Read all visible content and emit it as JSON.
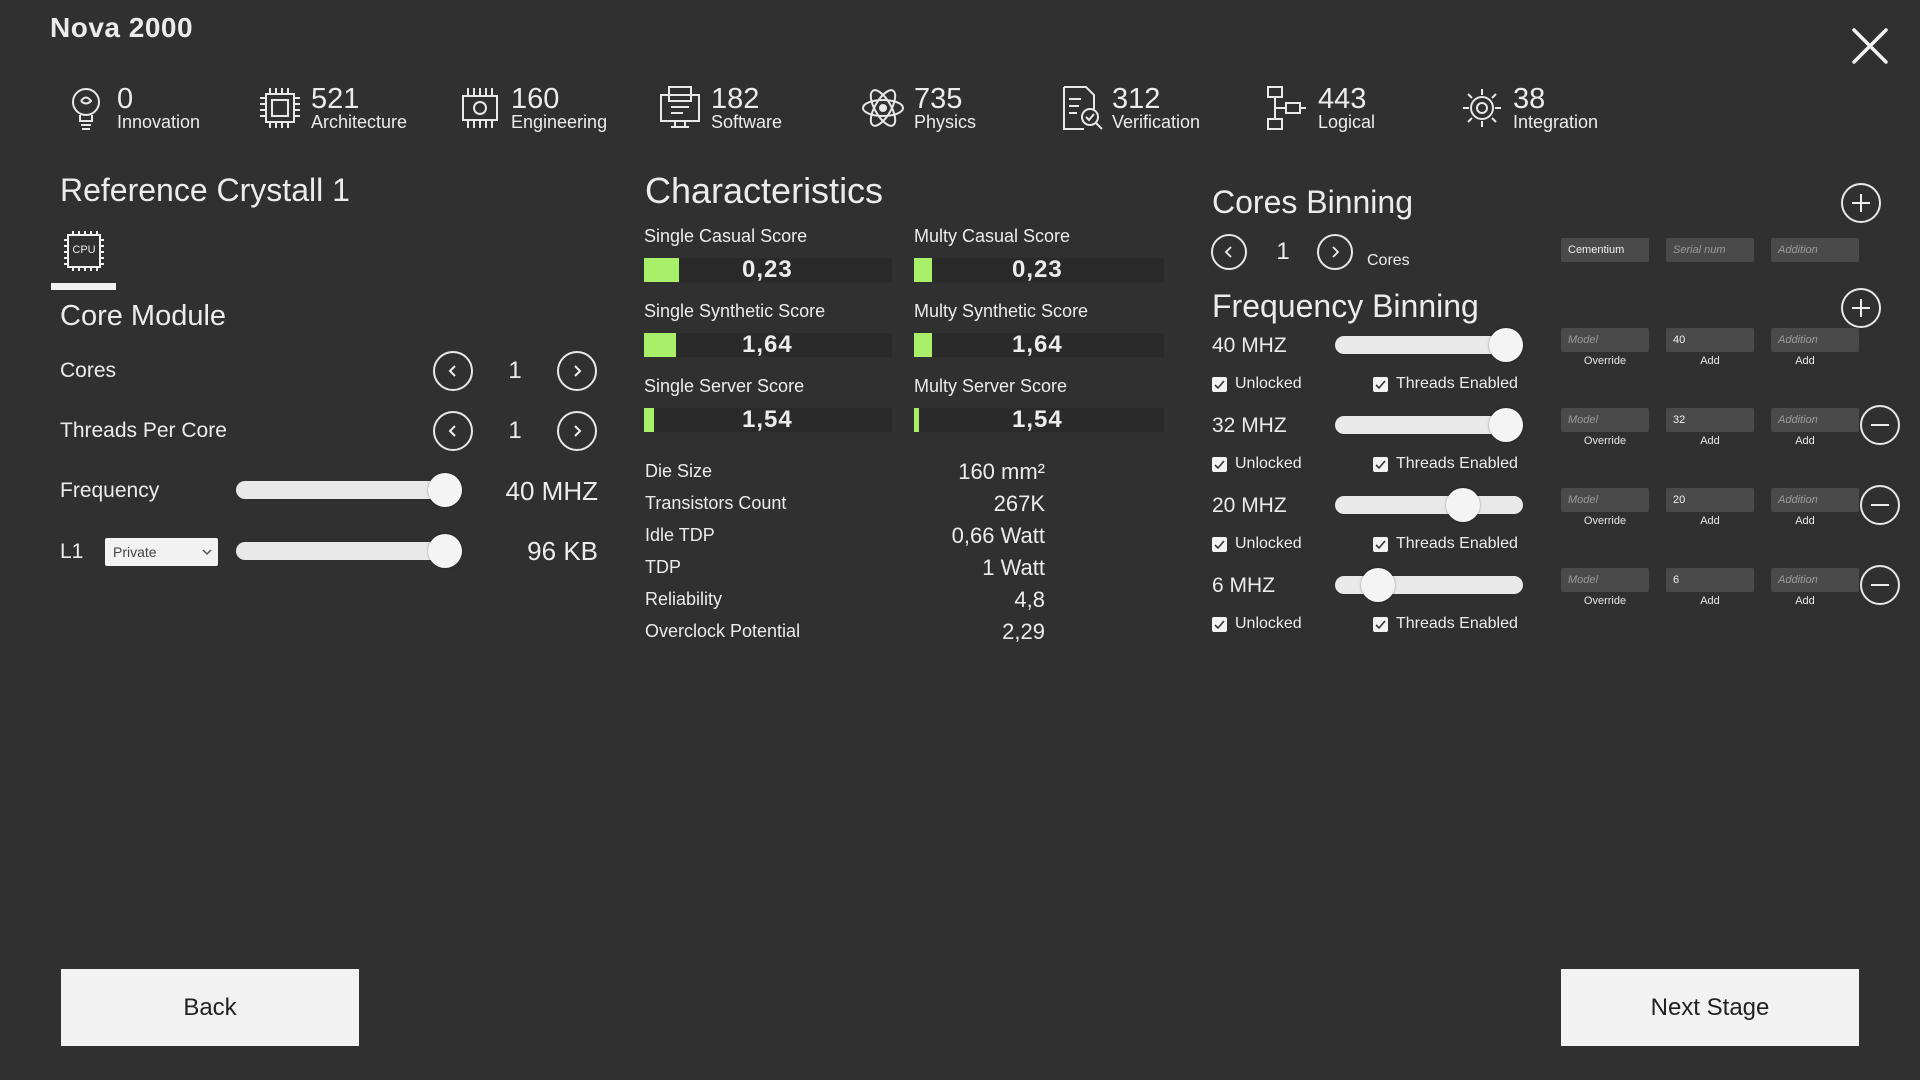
{
  "app": {
    "title": "Nova 2000"
  },
  "resources": [
    {
      "icon": "lightbulb-brain-icon",
      "value": "0",
      "label": "Innovation"
    },
    {
      "icon": "architecture-chip-icon",
      "value": "521",
      "label": "Architecture"
    },
    {
      "icon": "engineering-chip-icon",
      "value": "160",
      "label": "Engineering"
    },
    {
      "icon": "software-computer-icon",
      "value": "182",
      "label": "Software"
    },
    {
      "icon": "atom-icon",
      "value": "735",
      "label": "Physics"
    },
    {
      "icon": "verification-document-icon",
      "value": "312",
      "label": "Verification"
    },
    {
      "icon": "logic-flow-icon",
      "value": "443",
      "label": "Logical"
    },
    {
      "icon": "gear-integration-icon",
      "value": "38",
      "label": "Integration"
    }
  ],
  "left": {
    "title": "Reference Crystall 1",
    "cpu_badge": "CPU",
    "module_title": "Core Module",
    "cores_label": "Cores",
    "cores_value": "1",
    "threads_label": "Threads Per Core",
    "threads_value": "1",
    "frequency_label": "Frequency",
    "frequency_value": "40 MHZ",
    "frequency_level": 1.0,
    "l1_label": "L1",
    "l1_select": "Private",
    "l1_value": "96 KB",
    "l1_level": 1.0
  },
  "characteristics": {
    "title": "Characteristics",
    "scores": [
      {
        "label": "Single Casual Score",
        "value": "0,23",
        "fill": 0.14
      },
      {
        "label": "Multy Casual Score",
        "value": "0,23",
        "fill": 0.07
      },
      {
        "label": "Single Synthetic Score",
        "value": "1,64",
        "fill": 0.13
      },
      {
        "label": "Multy Synthetic Score",
        "value": "1,64",
        "fill": 0.07
      },
      {
        "label": "Single Server Score",
        "value": "1,54",
        "fill": 0.04
      },
      {
        "label": "Multy Server Score",
        "value": "1,54",
        "fill": 0.02
      }
    ],
    "specs": [
      {
        "label": "Die Size",
        "value": "160 mm²"
      },
      {
        "label": "Transistors Count",
        "value": "267K"
      },
      {
        "label": "Idle TDP",
        "value": "0,66 Watt"
      },
      {
        "label": "TDP",
        "value": "1 Watt"
      },
      {
        "label": "Reliability",
        "value": "4,8"
      },
      {
        "label": "Overclock Potential",
        "value": "2,29"
      }
    ]
  },
  "binning": {
    "cores_title": "Cores Binning",
    "cores_value": "1",
    "cores_unit": "Cores",
    "cores_inputs": {
      "material": "Cementium",
      "serial_placeholder": "Serial num",
      "addition_placeholder": "Addition"
    },
    "freq_title": "Frequency Binning",
    "model_placeholder": "Model",
    "addition_placeholder": "Addition",
    "override_label": "Override",
    "add_label": "Add",
    "unlocked_label": "Unlocked",
    "threads_label": "Threads Enabled",
    "rows": [
      {
        "freq": "40 MHZ",
        "level": 1.0,
        "value": "40"
      },
      {
        "freq": "32 MHZ",
        "level": 1.0,
        "value": "32"
      },
      {
        "freq": "20 MHZ",
        "level": 0.72,
        "value": "20"
      },
      {
        "freq": "6 MHZ",
        "level": 0.17,
        "value": "6"
      }
    ]
  },
  "footer": {
    "back_label": "Back",
    "next_label": "Next Stage"
  }
}
